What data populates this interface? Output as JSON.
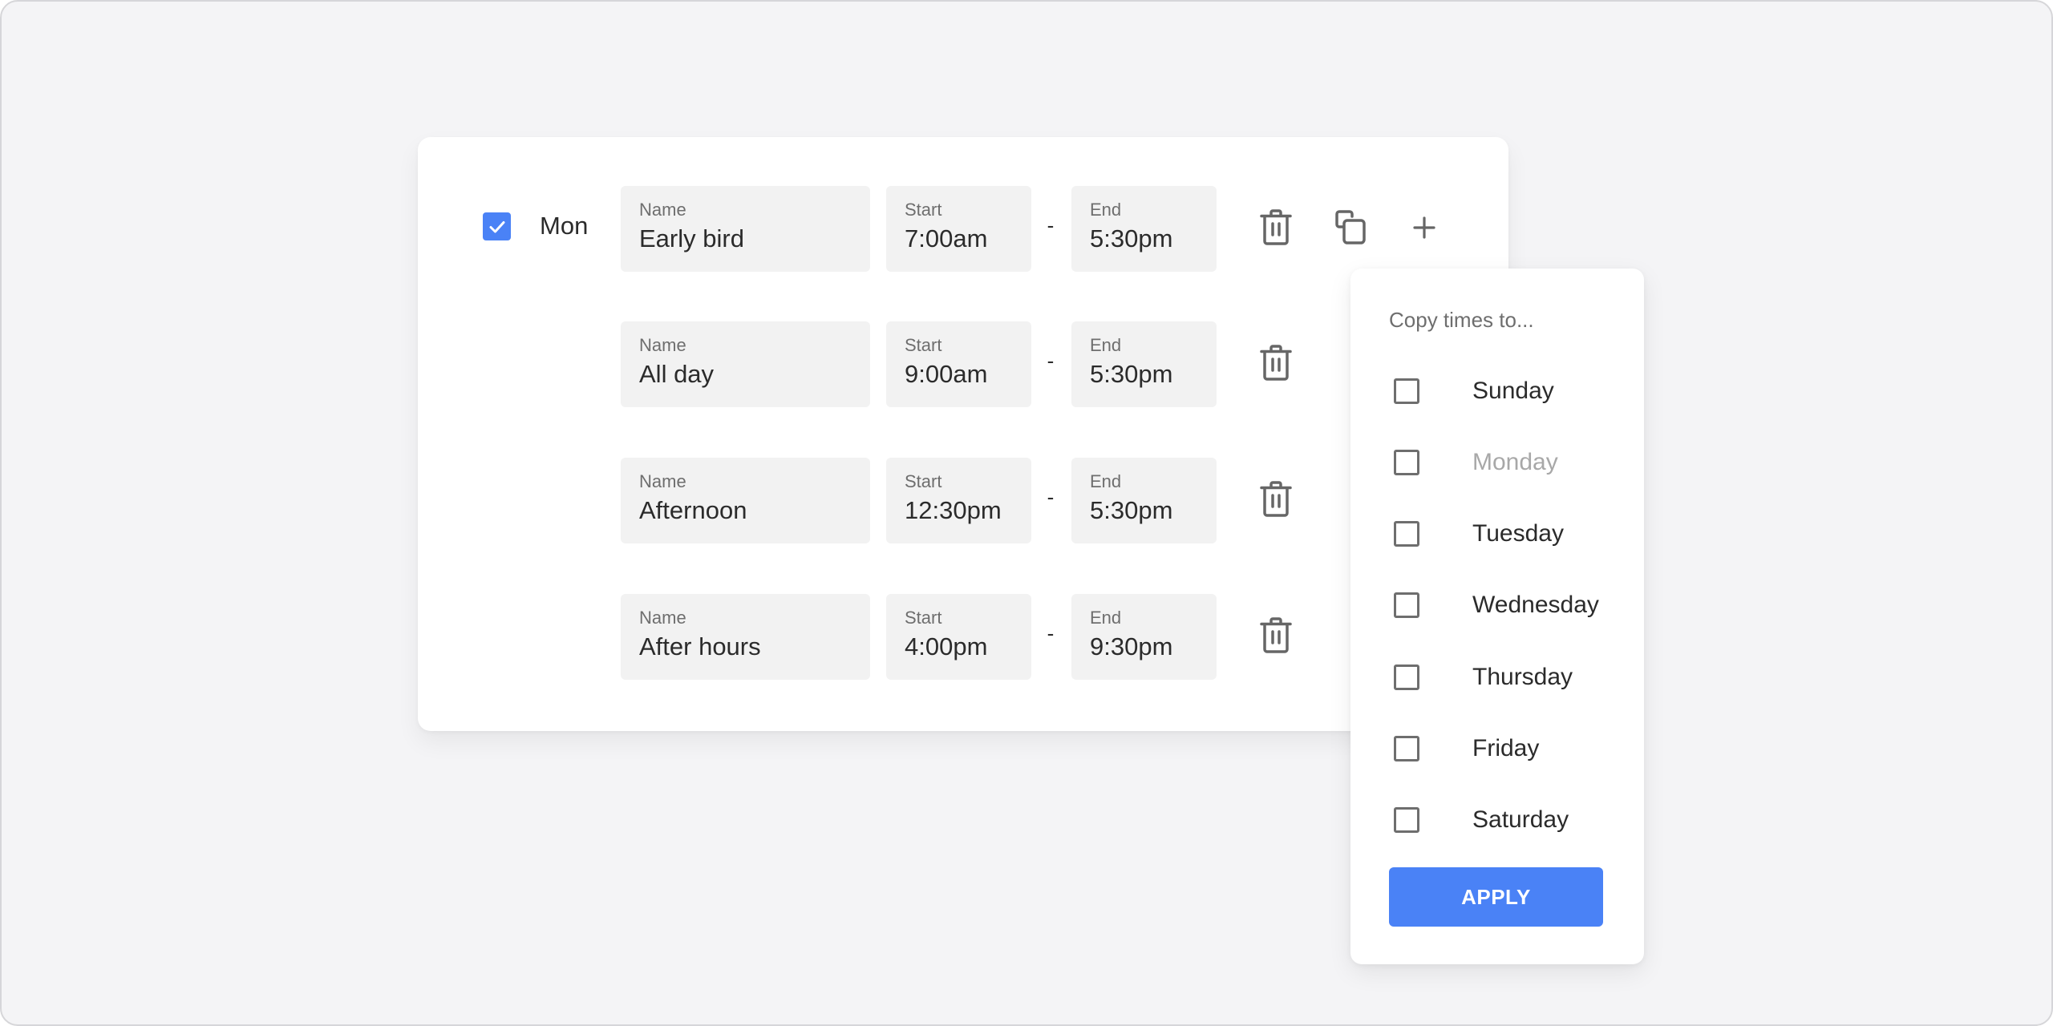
{
  "schedule": {
    "day": {
      "label": "Mon",
      "checked": true
    },
    "field_labels": {
      "name": "Name",
      "start": "Start",
      "end": "End"
    },
    "separator": "-",
    "rows": [
      {
        "name": "Early bird",
        "start": "7:00am",
        "end": "5:30pm"
      },
      {
        "name": "All day",
        "start": "9:00am",
        "end": "5:30pm"
      },
      {
        "name": "Afternoon",
        "start": "12:30pm",
        "end": "5:30pm"
      },
      {
        "name": "After hours",
        "start": "4:00pm",
        "end": "9:30pm"
      }
    ],
    "actions": {
      "delete_icon": "trash-icon",
      "copy_icon": "copy-icon",
      "add_icon": "plus-icon"
    }
  },
  "copy_popup": {
    "title": "Copy times to...",
    "options": [
      {
        "label": "Sunday",
        "checked": false,
        "disabled": false
      },
      {
        "label": "Monday",
        "checked": false,
        "disabled": true
      },
      {
        "label": "Tuesday",
        "checked": false,
        "disabled": false
      },
      {
        "label": "Wednesday",
        "checked": false,
        "disabled": false
      },
      {
        "label": "Thursday",
        "checked": false,
        "disabled": false
      },
      {
        "label": "Friday",
        "checked": false,
        "disabled": false
      },
      {
        "label": "Saturday",
        "checked": false,
        "disabled": false
      }
    ],
    "apply_label": "APPLY"
  },
  "colors": {
    "accent": "#4a82f6",
    "field_bg": "#f2f2f2",
    "page_bg": "#f4f4f6",
    "disabled_text": "#a8a8a8"
  }
}
